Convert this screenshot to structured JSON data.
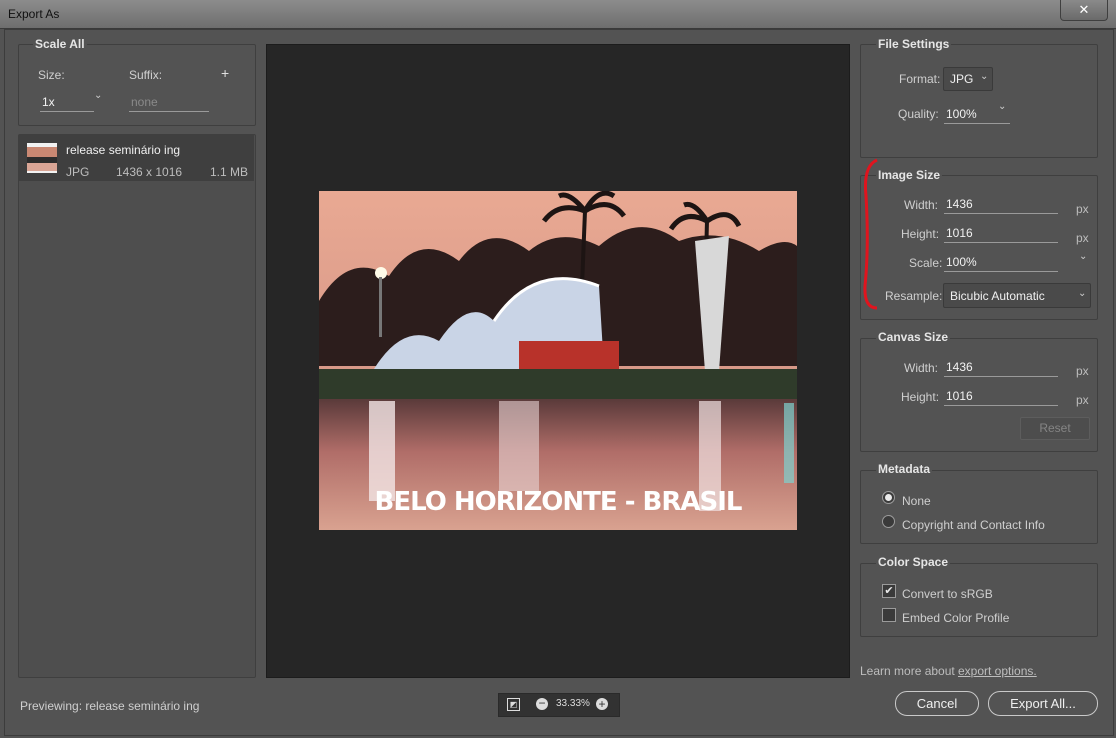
{
  "window": {
    "title": "Export As",
    "close_glyph": "✕"
  },
  "scale_all": {
    "title": "Scale All",
    "size_label": "Size:",
    "size_value": "1x",
    "suffix_label": "Suffix:",
    "suffix_placeholder": "none",
    "add_glyph": "+"
  },
  "asset": {
    "name": "release seminário ing",
    "format": "JPG",
    "dimensions": "1436 x 1016",
    "filesize": "1.1 MB"
  },
  "preview": {
    "caption": "BELO HORIZONTE - BRASIL",
    "status_label": "Previewing:",
    "status_name": "release seminário ing",
    "zoom": "33.33%"
  },
  "file_settings": {
    "title": "File Settings",
    "format_label": "Format:",
    "format_value": "JPG",
    "quality_label": "Quality:",
    "quality_value": "100%"
  },
  "image_size": {
    "title": "Image Size",
    "width_label": "Width:",
    "width_value": "1436",
    "height_label": "Height:",
    "height_value": "1016",
    "scale_label": "Scale:",
    "scale_value": "100%",
    "resample_label": "Resample:",
    "resample_value": "Bicubic Automatic",
    "unit": "px"
  },
  "canvas_size": {
    "title": "Canvas Size",
    "width_label": "Width:",
    "width_value": "1436",
    "height_label": "Height:",
    "height_value": "1016",
    "unit": "px",
    "reset_label": "Reset"
  },
  "metadata": {
    "title": "Metadata",
    "options": [
      "None",
      "Copyright and Contact Info"
    ],
    "selected": "None"
  },
  "color_space": {
    "title": "Color Space",
    "convert_label": "Convert to sRGB",
    "convert_checked": true,
    "embed_label": "Embed Color Profile",
    "embed_checked": false
  },
  "footer": {
    "learn_more_text": "Learn more about",
    "learn_more_link": "export options.",
    "cancel_label": "Cancel",
    "export_label": "Export All..."
  },
  "colors": {
    "annotation_red": "#e0141e",
    "panel_bg": "#535353",
    "preview_bg": "#262626"
  }
}
